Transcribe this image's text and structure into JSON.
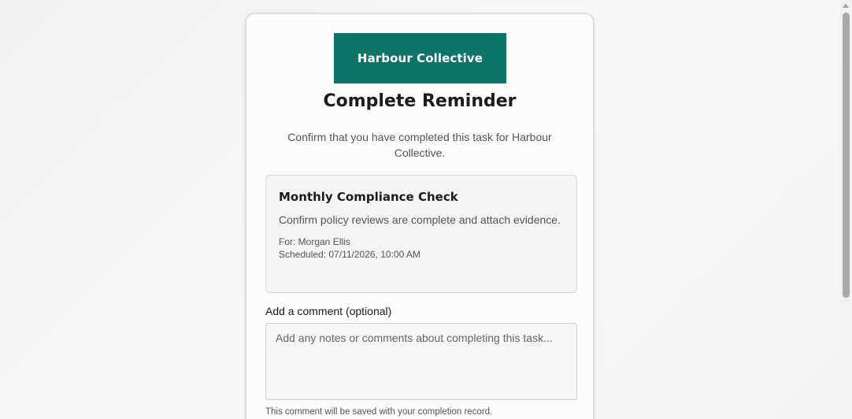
{
  "brand": {
    "logo_text": "Harbour Collective",
    "accent_color": "#0e7468"
  },
  "page": {
    "title": "Complete Reminder",
    "subtitle": "Confirm that you have completed this task for Harbour Collective."
  },
  "task": {
    "title": "Monthly Compliance Check",
    "description": "Confirm policy reviews are complete and attach evidence.",
    "for_line": "For: Morgan Ellis",
    "scheduled_line": "Scheduled: 07/11/2026, 10:00 AM"
  },
  "comment": {
    "label": "Add a comment (optional)",
    "value": "",
    "placeholder": "Add any notes or comments about completing this task...",
    "helper": "This comment will be saved with your completion record."
  },
  "scrollbar": {
    "icon_up": "arrow-up-icon"
  }
}
